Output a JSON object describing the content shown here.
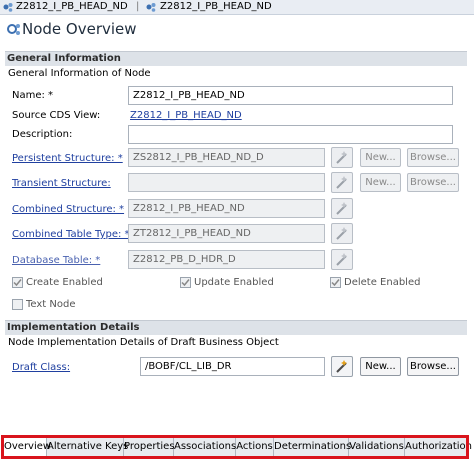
{
  "breadcrumbs": [
    "Z2812_I_PB_HEAD_ND",
    "Z2812_I_PB_HEAD_ND"
  ],
  "page_title": "Node Overview",
  "general": {
    "section_title": "General Information",
    "subtitle": "General Information of Node",
    "name_label": "Name: *",
    "name_value": "Z2812_I_PB_HEAD_ND",
    "source_cds_label": "Source CDS View:",
    "source_cds_value": "Z2812_I_PB_HEAD_ND",
    "description_label": "Description:",
    "description_value": "",
    "persistent_label": "Persistent Structure: *",
    "persistent_value": "ZS2812_I_PB_HEAD_ND_D",
    "transient_label": "Transient Structure:",
    "transient_value": "",
    "combined_label": "Combined Structure: *",
    "combined_value": "Z2812_I_PB_HEAD_ND",
    "combined_table_label": "Combined Table Type: *",
    "combined_table_value": "ZT2812_I_PB_HEAD_ND",
    "database_label": "Database Table: *",
    "database_value": "Z2812_PB_D_HDR_D",
    "new_label": "New...",
    "browse_label": "Browse...",
    "create_enabled": "Create Enabled",
    "update_enabled": "Update Enabled",
    "delete_enabled": "Delete Enabled",
    "text_node": "Text Node"
  },
  "implementation": {
    "section_title": "Implementation Details",
    "subtitle": "Node Implementation Details of Draft Business Object",
    "draft_class_label": "Draft Class:",
    "draft_class_value": "/BOBF/CL_LIB_DR",
    "new_label": "New...",
    "browse_label": "Browse..."
  },
  "tabs": [
    "Overview",
    "Alternative Keys",
    "Properties",
    "Associations",
    "Actions",
    "Determinations",
    "Validations",
    "Authorization"
  ],
  "colors": {
    "highlight": "#d9141c",
    "link": "#2040a0",
    "section_bg": "#dde2e8"
  },
  "icons": [
    "node-icon",
    "node-overview-icon",
    "wand-icon"
  ]
}
